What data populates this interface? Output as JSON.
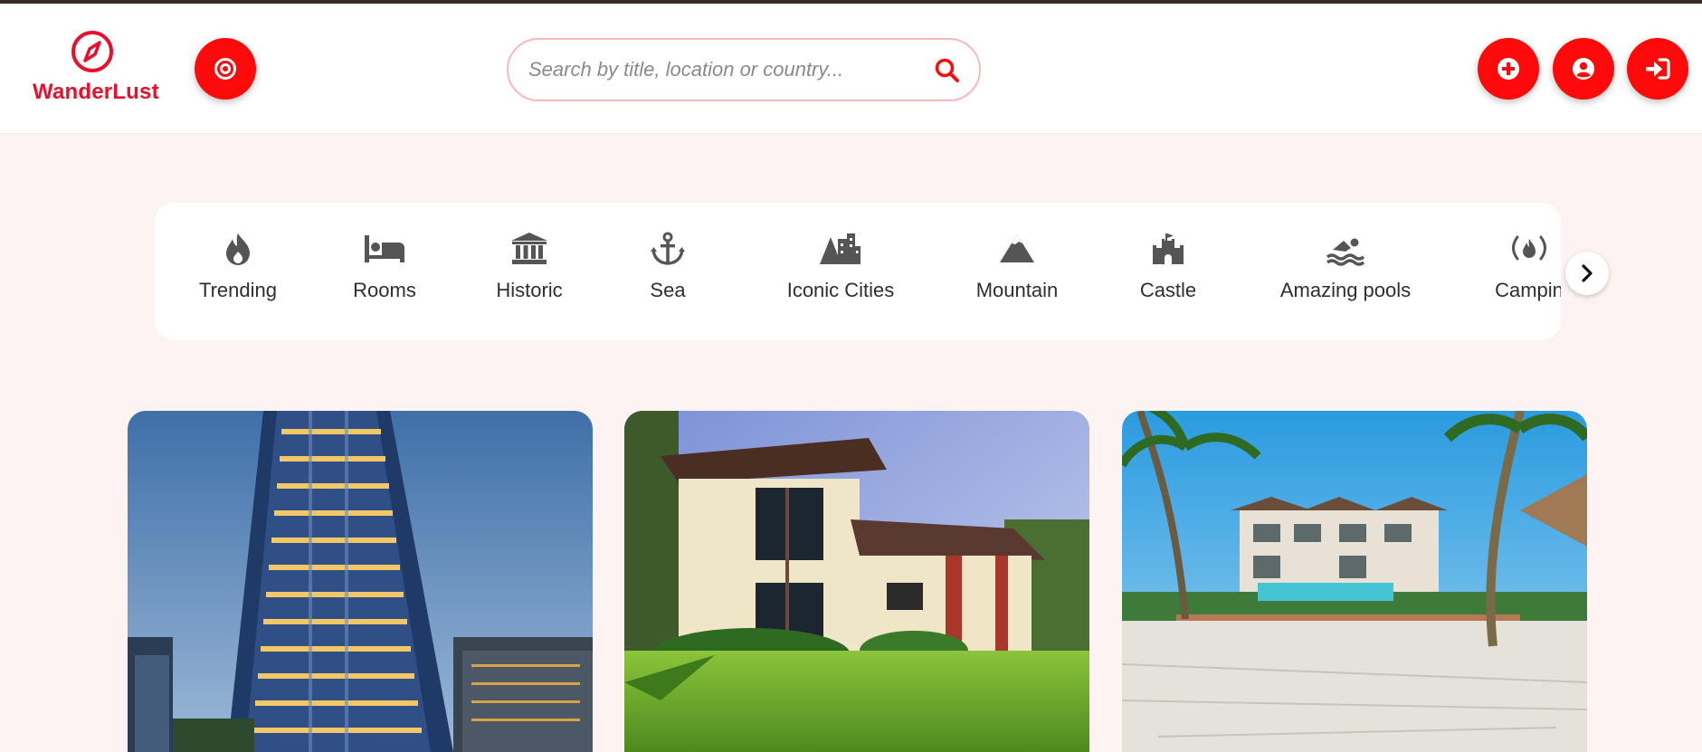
{
  "app": {
    "brand": "WanderLust",
    "logo_icon": "compass-icon",
    "accent": "#ff0a0a",
    "brand_color": "#e8102a"
  },
  "header": {
    "target_button_icon": "target-icon",
    "search": {
      "placeholder": "Search by title, location or country...",
      "value": "",
      "icon": "search-icon"
    },
    "actions": [
      {
        "name": "add-listing-button",
        "icon": "plus-circle-icon"
      },
      {
        "name": "profile-button",
        "icon": "user-circle-icon"
      },
      {
        "name": "login-button",
        "icon": "sign-in-icon"
      }
    ]
  },
  "categories": [
    {
      "label": "Trending",
      "icon": "fire-icon"
    },
    {
      "label": "Rooms",
      "icon": "bed-icon"
    },
    {
      "label": "Historic",
      "icon": "landmark-icon"
    },
    {
      "label": "Sea",
      "icon": "anchor-icon"
    },
    {
      "label": "Iconic Cities",
      "icon": "mountain-city-icon"
    },
    {
      "label": "Mountain",
      "icon": "mountain-icon"
    },
    {
      "label": "Castle",
      "icon": "castle-icon"
    },
    {
      "label": "Amazing pools",
      "icon": "swimmer-icon"
    },
    {
      "label": "Campin",
      "icon": "campfire-icon"
    }
  ],
  "carousel": {
    "next_icon": "chevron-right-icon"
  },
  "listings": [
    {
      "image": "highrise-tower-photo"
    },
    {
      "image": "modern-house-photo"
    },
    {
      "image": "beach-villa-photo"
    }
  ]
}
